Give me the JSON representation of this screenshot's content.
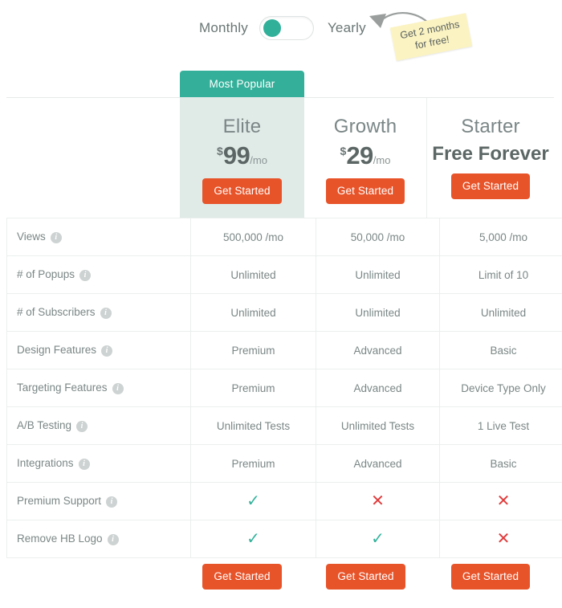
{
  "billing_toggle": {
    "monthly_label": "Monthly",
    "yearly_label": "Yearly",
    "selected": "Monthly"
  },
  "promo_note": {
    "line1": "Get 2 months",
    "line2": "for free!"
  },
  "badge": {
    "label": "Most Popular"
  },
  "plans": [
    {
      "key": "elite",
      "name": "Elite",
      "currency": "$",
      "amount": "99",
      "period": "/mo",
      "cta": "Get Started",
      "highlighted": true
    },
    {
      "key": "growth",
      "name": "Growth",
      "currency": "$",
      "amount": "29",
      "period": "/mo",
      "cta": "Get Started",
      "highlighted": false
    },
    {
      "key": "starter",
      "name": "Starter",
      "price_text": "Free Forever",
      "cta": "Get Started",
      "highlighted": false
    }
  ],
  "features": [
    {
      "label": "Views",
      "elite": "500,000 /mo",
      "growth": "50,000 /mo",
      "starter": "5,000 /mo"
    },
    {
      "label": "# of Popups",
      "elite": "Unlimited",
      "growth": "Unlimited",
      "starter": "Limit of 10"
    },
    {
      "label": "# of Subscribers",
      "elite": "Unlimited",
      "growth": "Unlimited",
      "starter": "Unlimited"
    },
    {
      "label": "Design Features",
      "elite": "Premium",
      "growth": "Advanced",
      "starter": "Basic"
    },
    {
      "label": "Targeting Features",
      "elite": "Premium",
      "growth": "Advanced",
      "starter": "Device Type Only"
    },
    {
      "label": "A/B Testing",
      "elite": "Unlimited Tests",
      "growth": "Unlimited Tests",
      "starter": "1 Live Test"
    },
    {
      "label": "Integrations",
      "elite": "Premium",
      "growth": "Advanced",
      "starter": "Basic"
    },
    {
      "label": "Premium Support",
      "elite": "✓",
      "growth": "✕",
      "starter": "✕"
    },
    {
      "label": "Remove HB Logo",
      "elite": "✓",
      "growth": "✓",
      "starter": "✕"
    }
  ],
  "info_icon_glyph": "i",
  "footer_cta": {
    "elite": "Get Started",
    "growth": "Get Started",
    "starter": "Get Started"
  },
  "colors": {
    "accent_teal": "#34b09a",
    "cta_orange": "#e8542a",
    "highlight_bg": "#e0ebe8",
    "note_yellow": "#fbf3c2",
    "check_green": "#35b39c",
    "cross_red": "#e03a3a",
    "border": "#eceeee"
  }
}
